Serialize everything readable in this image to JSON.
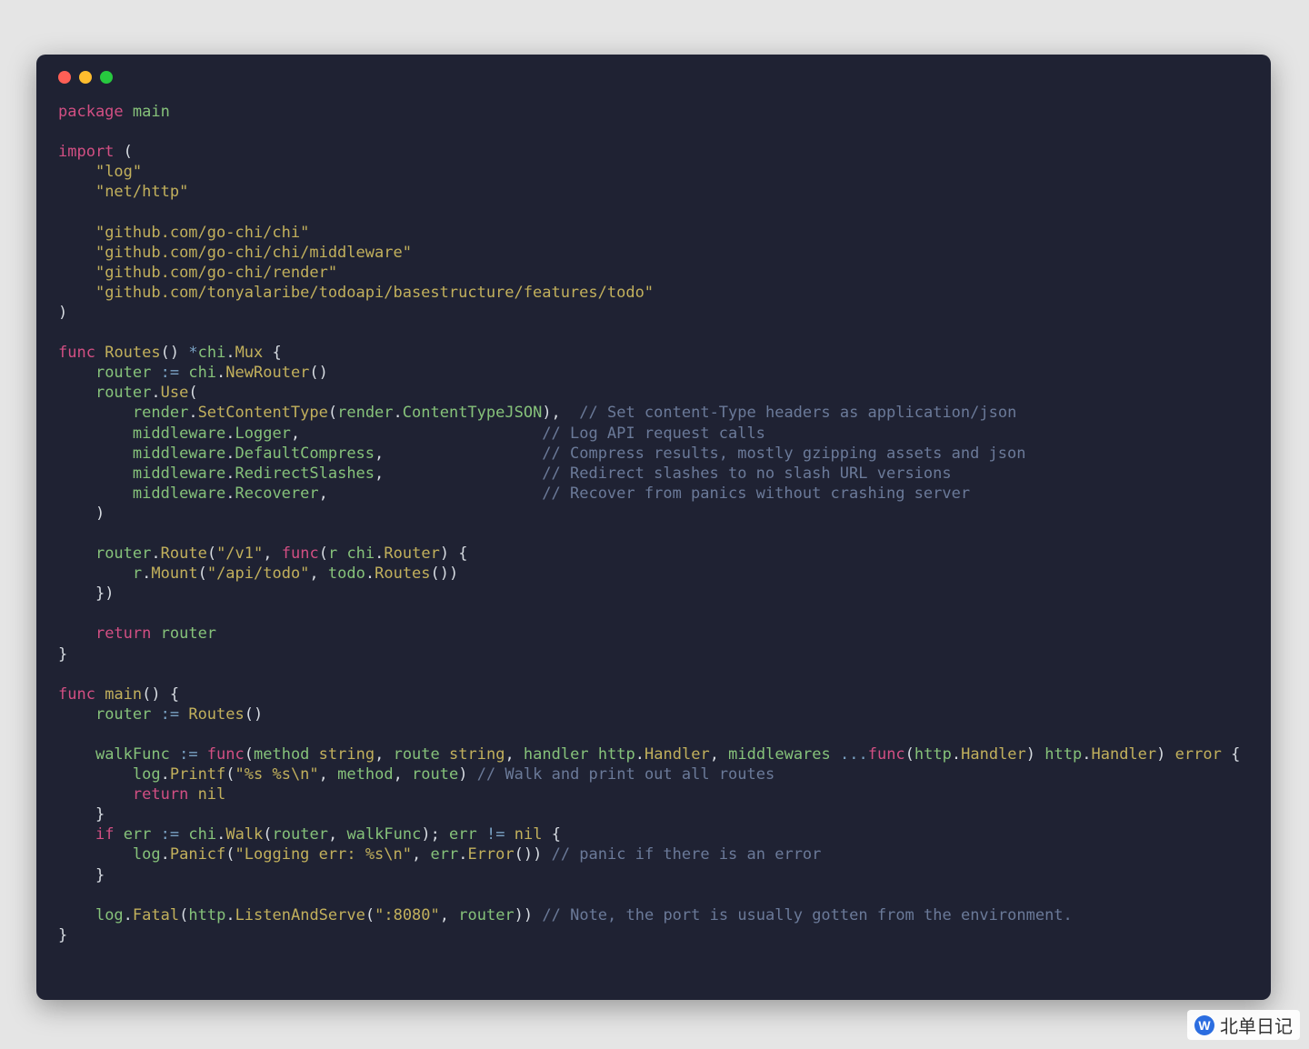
{
  "window": {
    "dots": [
      "red",
      "yellow",
      "green"
    ]
  },
  "watermark": {
    "badge": "W",
    "text": "北单日记"
  },
  "syntax_colors": {
    "keyword": "#d24f83",
    "identifier": "#86c27a",
    "function": "#c2b05c",
    "punct": "#d7dce2",
    "operator": "#7aa2c4",
    "string": "#c2b05c",
    "type": "#c2b05c",
    "comment": "#6b7a99",
    "background": "#1f2233"
  },
  "code": {
    "language": "go",
    "package": "main",
    "imports": [
      "log",
      "net/http",
      "github.com/go-chi/chi",
      "github.com/go-chi/chi/middleware",
      "github.com/go-chi/render",
      "github.com/tonyalaribe/todoapi/basestructure/features/todo"
    ],
    "routes_return_type": "*chi.Mux",
    "middlewares": [
      {
        "call": "render.SetContentType(render.ContentTypeJSON)",
        "comment": "// Set content-Type headers as application/json"
      },
      {
        "call": "middleware.Logger",
        "comment": "// Log API request calls"
      },
      {
        "call": "middleware.DefaultCompress",
        "comment": "// Compress results, mostly gzipping assets and json"
      },
      {
        "call": "middleware.RedirectSlashes",
        "comment": "// Redirect slashes to no slash URL versions"
      },
      {
        "call": "middleware.Recoverer",
        "comment": "// Recover from panics without crashing server"
      }
    ],
    "route_group": {
      "path": "/v1",
      "mount": {
        "path": "/api/todo",
        "call": "todo.Routes()"
      }
    },
    "walk_comment": "// Walk and print out all routes",
    "panic_comment": "// panic if there is an error",
    "listen_port": ":8080",
    "listen_comment": "// Note, the port is usually gotten from the environment.",
    "log_printf_format": "%s %s\\n",
    "log_panicf_format": "Logging err: %s\\n"
  },
  "tokens": {
    "package": "package",
    "main1": "main",
    "import": "import",
    "op_paren": "(",
    "imp1": "\"log\"",
    "imp2": "\"net/http\"",
    "imp3": "\"github.com/go-chi/chi\"",
    "imp4": "\"github.com/go-chi/chi/middleware\"",
    "imp5": "\"github.com/go-chi/render\"",
    "imp6": "\"github.com/tonyalaribe/todoapi/basestructure/features/todo\"",
    "cl_paren": ")",
    "func": "func",
    "routes": "Routes",
    "empty_args": "() ",
    "star": "*",
    "chi": "chi",
    "dot": ".",
    "mux": "Mux",
    "ob": " {",
    "router": "router",
    "asg": " := ",
    "newrouter": "NewRouter",
    "paren_pair": "()",
    "use": "Use",
    "op": "(",
    "render": "render",
    "setct": "SetContentType",
    "ctjson": "ContentTypeJSON",
    "comma_close": "),",
    "sp_to_c1": "  ",
    "mw": "middleware",
    "logger": "Logger",
    "comma": ",",
    "sp_to_c2": "                          ",
    "defcomp": "DefaultCompress",
    "sp_to_c3": "                 ",
    "redirs": "RedirectSlashes",
    "sp_to_c4": "                 ",
    "recov": "Recoverer",
    "sp_to_c5": "                       ",
    "cmt1": "// Set content-Type headers as application/json",
    "cmt2": "// Log API request calls",
    "cmt3": "// Compress results, mostly gzipping assets and json",
    "cmt4": "// Redirect slashes to no slash URL versions",
    "cmt5": "// Recover from panics without crashing server",
    "close_paren": ")",
    "route": "Route",
    "v1": "\"/v1\"",
    "cm2": ", ",
    "funckw": "func",
    "r": "r",
    "rtr": "Router",
    "close_ob": ") {",
    "mount": "Mount",
    "apit": "\"/api/todo\"",
    "todo": "todo",
    "routes2": "Routes",
    "close_inner": "())",
    "close_rt": "})",
    "return": "return",
    "router2": "router",
    "cb": "}",
    "main2": "main",
    "noarg": "() {",
    "routes_call": "Routes",
    "call_it": "()",
    "walkFunc": "walkFunc",
    "funckw2": "func",
    "method": "method",
    "str_t": "string",
    "route_p": "route",
    "handler": "handler",
    "http": "http",
    "Handler": "Handler",
    "middlewares": "middlewares",
    "dots": " ...",
    "error": "error",
    "open_b": " {",
    "log": "log",
    "Printf": "Printf",
    "fmt1": "\"%s %s\\n\"",
    "method2": "method",
    "route2": "route",
    "close2": ") ",
    "walkc": "// Walk and print out all routes",
    "ret2": "return",
    "nil": "nil",
    "if": "if",
    "err": "err",
    "walk": "Walk",
    "walkf": "walkFunc",
    "close3": "); ",
    "neq": "!=",
    "nil2": "nil",
    "Panicf": "Panicf",
    "fmt2": "\"Logging err: %s\\n\"",
    "Error": "Error",
    "close4": "()) ",
    "panc": "// panic if there is an error",
    "Fatal": "Fatal",
    "LAS": "ListenAndServe",
    "port": "\":8080\"",
    "router3": "router",
    "close5": ")) ",
    "lcmt": "// Note, the port is usually gotten from the environment."
  }
}
